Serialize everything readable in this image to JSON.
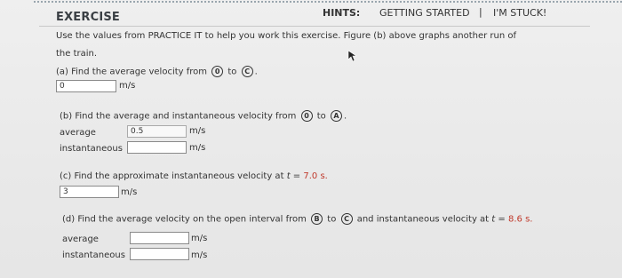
{
  "header": {
    "title": "EXERCISE",
    "hints_label": "HINTS:",
    "getting_started": "GETTING STARTED",
    "separator": "|",
    "stuck": "I'M STUCK!"
  },
  "intro": {
    "line1": "Use the values from PRACTICE IT to help you work this exercise. Figure (b) above graphs another run of",
    "line2": "the train."
  },
  "part_a": {
    "prefix": "(a) Find the average velocity from",
    "point1": "0",
    "to": "to",
    "point2": "C",
    "end": ".",
    "input_value": "0",
    "unit": "m/s"
  },
  "part_b": {
    "prefix": "(b) Find the average and instantaneous velocity from",
    "point1": "0",
    "to": "to",
    "point2": "A",
    "end": ".",
    "avg_label": "average",
    "avg_value": "0.5",
    "avg_unit": "m/s",
    "inst_label": "instantaneous",
    "inst_value": "",
    "inst_unit": "m/s"
  },
  "part_c": {
    "prefix": "(c) Find the approximate instantaneous velocity at",
    "var": "t",
    "eq": "=",
    "value": "7.0 s.",
    "input_value": "3",
    "unit": "m/s"
  },
  "part_d": {
    "prefix": "(d) Find the average velocity on the open interval from",
    "point1": "B",
    "to": "to",
    "point2": "C",
    "mid": "and instantaneous velocity at",
    "var": "t",
    "eq": "=",
    "value": "8.6 s.",
    "avg_label": "average",
    "avg_value": "",
    "avg_unit": "m/s",
    "inst_label": "instantaneous",
    "inst_value": "",
    "inst_unit": "m/s"
  }
}
